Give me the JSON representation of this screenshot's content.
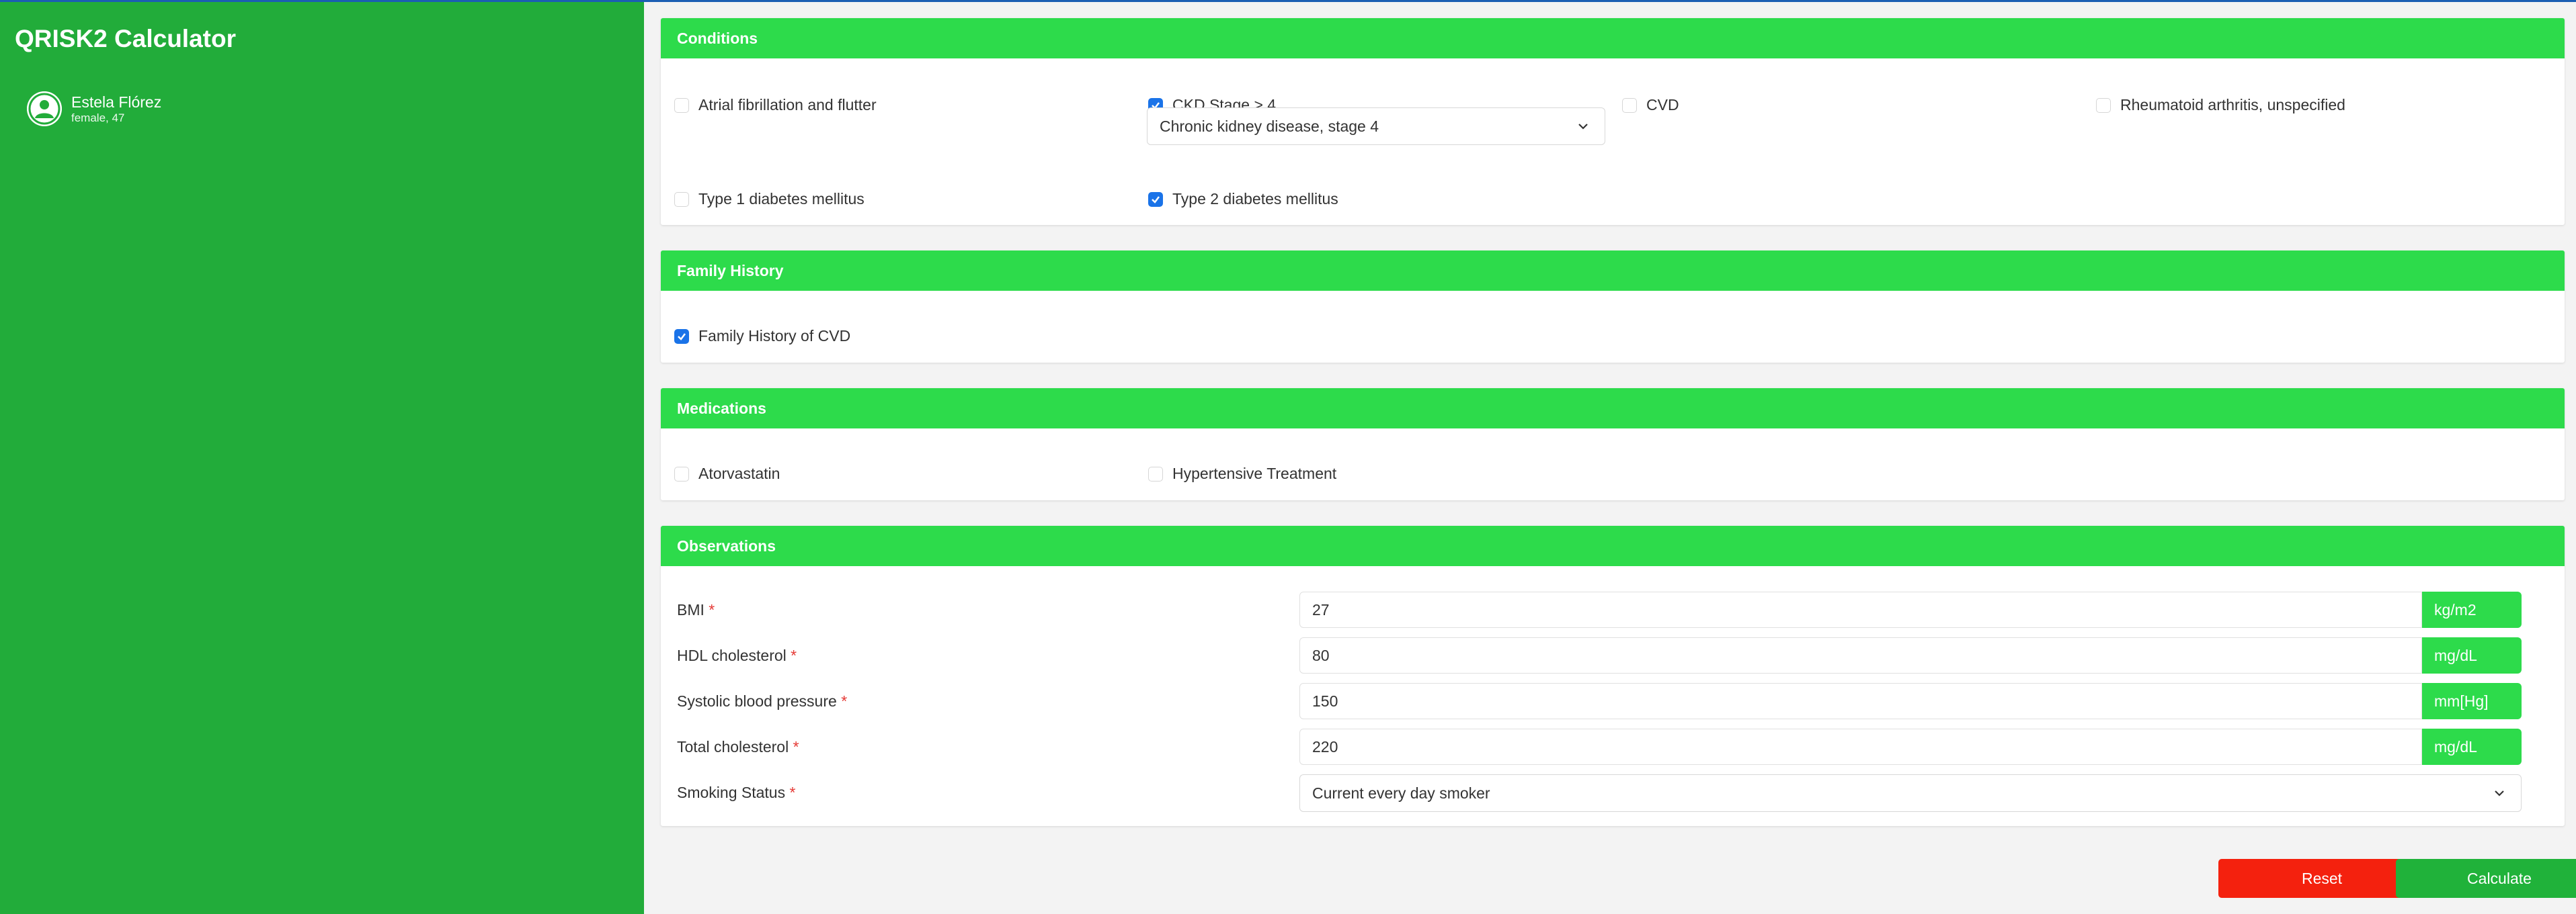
{
  "app": {
    "title": "QRISK2 Calculator"
  },
  "patient": {
    "name": "Estela Flórez",
    "details": "female, 47"
  },
  "conditions": {
    "header": "Conditions",
    "items": [
      {
        "label": "Atrial fibrillation and flutter",
        "checked": false
      },
      {
        "label": "CKD Stage > 4",
        "checked": true
      },
      {
        "label": "CVD",
        "checked": false
      },
      {
        "label": "Rheumatoid arthritis, unspecified",
        "checked": false
      },
      {
        "label": "Type 1 diabetes mellitus",
        "checked": false
      },
      {
        "label": "Type 2 diabetes mellitus",
        "checked": true
      }
    ],
    "ckd_select": "Chronic kidney disease, stage 4"
  },
  "family_history": {
    "header": "Family History",
    "items": [
      {
        "label": "Family History of CVD",
        "checked": true
      }
    ]
  },
  "medications": {
    "header": "Medications",
    "items": [
      {
        "label": "Atorvastatin",
        "checked": false
      },
      {
        "label": "Hypertensive Treatment",
        "checked": false
      }
    ]
  },
  "observations": {
    "header": "Observations",
    "required_marker": "*",
    "fields": [
      {
        "label": "BMI",
        "value": "27",
        "unit": "kg/m2"
      },
      {
        "label": "HDL cholesterol",
        "value": "80",
        "unit": "mg/dL"
      },
      {
        "label": "Systolic blood pressure",
        "value": "150",
        "unit": "mm[Hg]"
      },
      {
        "label": "Total cholesterol",
        "value": "220",
        "unit": "mg/dL"
      }
    ],
    "smoking": {
      "label": "Smoking Status",
      "value": "Current every day smoker"
    }
  },
  "actions": {
    "reset": "Reset",
    "calculate": "Calculate"
  },
  "colors": {
    "sidebar": "#22ac3a",
    "panel_header": "#2ddb4b",
    "reset": "#f4210e",
    "calculate": "#20b23a",
    "checkbox_checked": "#1a73e8"
  }
}
